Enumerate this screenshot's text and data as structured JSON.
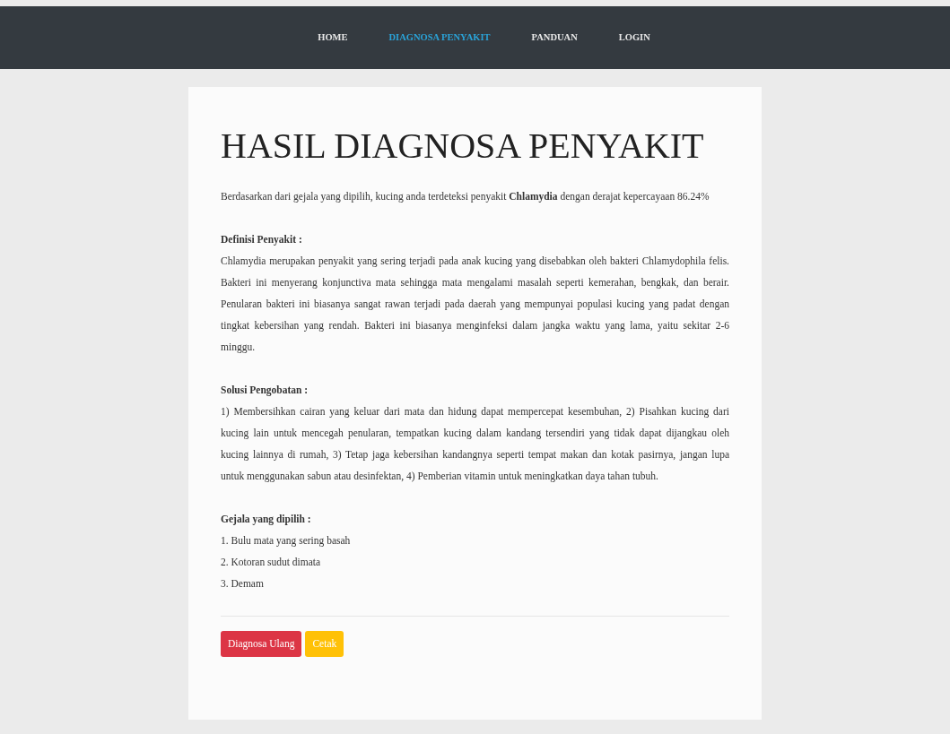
{
  "navbar": {
    "items": [
      {
        "label": "HOME",
        "selected": false
      },
      {
        "label": "DIAGNOSA PENYAKIT",
        "selected": true
      },
      {
        "label": "PANDUAN",
        "selected": false
      },
      {
        "label": "LOGIN",
        "selected": false
      }
    ]
  },
  "title": "HASIL DIAGNOSA PENYAKIT",
  "result": "Berdasarkan dari gejala yang dipilih, kucing anda terdeteksi penyakit **Chlamydia** dengan derajat kepercayaan 86.24%",
  "sections": [
    {
      "heading": "Definisi Penyakit :",
      "text": "Chlamydia merupakan penyakit yang sering terjadi pada anak kucing yang disebabkan oleh bakteri Chlamydophila felis. Bakteri ini menyerang konjunctiva mata sehingga mata mengalami masalah seperti kemerahan, bengkak, dan berair. Penularan bakteri ini biasanya sangat rawan terjadi pada daerah yang mempunyai populasi kucing yang padat dengan tingkat kebersihan yang rendah. Bakteri ini biasanya menginfeksi dalam jangka waktu yang lama, yaitu sekitar 2-6 minggu."
    },
    {
      "heading": "Solusi Pengobatan :",
      "text": "1) Membersihkan cairan yang keluar dari mata dan hidung dapat mempercepat kesembuhan, 2) Pisahkan kucing dari kucing lain untuk mencegah penularan, tempatkan kucing dalam kandang tersendiri yang tidak dapat dijangkau oleh kucing lainnya di rumah, 3) Tetap jaga kebersihan kandangnya seperti tempat makan dan kotak pasirnya, jangan lupa untuk menggunakan sabun atau desinfektan, 4) Pemberian vitamin untuk meningkatkan daya tahan tubuh."
    }
  ],
  "symptoms": {
    "heading": "Gejala yang dipilih :",
    "items": [
      "1. Bulu mata yang sering basah",
      "2. Kotoran sudut dimata",
      "3. Demam"
    ]
  },
  "buttons": [
    {
      "label": "Diagnosa Ulang",
      "kind": "danger"
    },
    {
      "label": "Cetak",
      "kind": "warning"
    }
  ]
}
